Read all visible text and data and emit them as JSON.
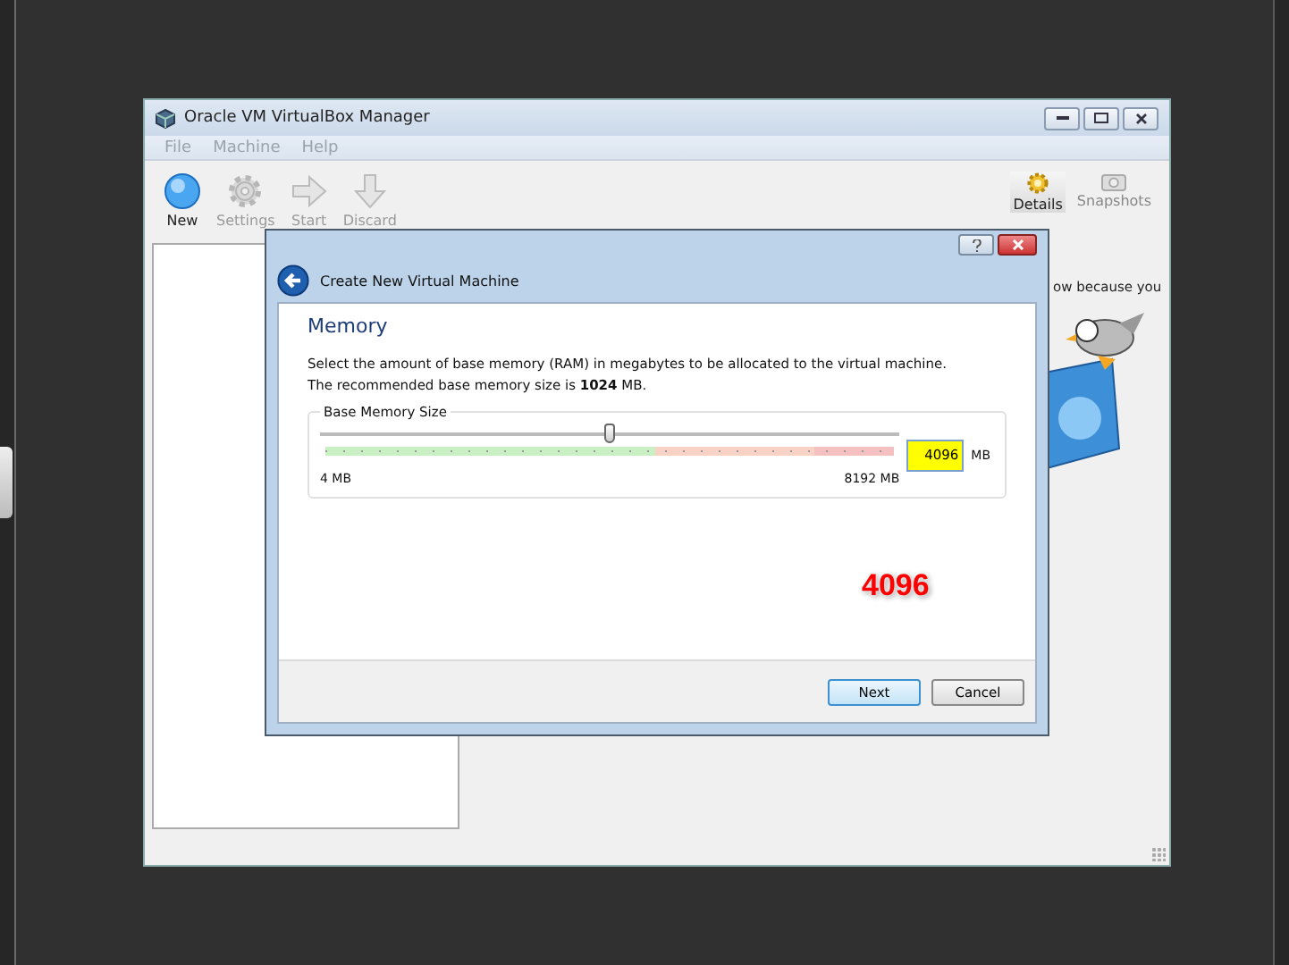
{
  "manager": {
    "title": "Oracle VM VirtualBox Manager",
    "menu": [
      "File",
      "Machine",
      "Help"
    ],
    "toolbar": [
      {
        "kind": "new",
        "label": "New",
        "disabled": false
      },
      {
        "kind": "settings",
        "label": "Settings",
        "disabled": true
      },
      {
        "kind": "start",
        "label": "Start",
        "disabled": true
      },
      {
        "kind": "discard",
        "label": "Discard",
        "disabled": true
      }
    ],
    "view_buttons": [
      {
        "kind": "details",
        "label": "Details",
        "selected": true
      },
      {
        "kind": "snapshots",
        "label": "Snapshots",
        "selected": false
      }
    ],
    "welcome_text": "ow because you"
  },
  "dialog": {
    "title": "Create New Virtual Machine",
    "heading": "Memory",
    "description": "Select the amount of base memory (RAM) in megabytes to be allocated to the virtual machine.",
    "recommendation": "The recommended base memory size is **1024** MB.",
    "group_label": "Base Memory Size",
    "slider": {
      "level": 0.5,
      "min_label": "4 MB",
      "max_label": "8192 MB"
    },
    "memory_field": {
      "value": "4096",
      "unit": "MB",
      "highlighted": true
    },
    "buttons": [
      {
        "label": "Next",
        "default": true
      },
      {
        "label": "Cancel",
        "default": false
      }
    ]
  },
  "annotation": "4096"
}
